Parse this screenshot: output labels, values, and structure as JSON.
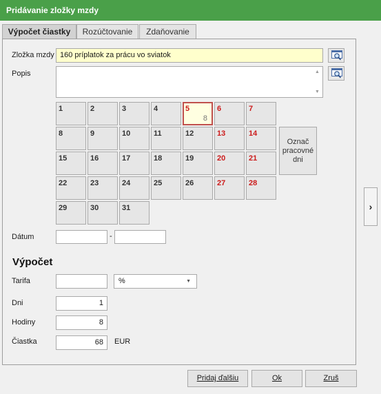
{
  "window": {
    "title": "Pridávanie zložky mzdy"
  },
  "tabs": [
    {
      "label": "Výpočet čiastky",
      "active": true
    },
    {
      "label": "Rozúčtovanie",
      "active": false
    },
    {
      "label": "Zdaňovanie",
      "active": false
    }
  ],
  "form": {
    "component_label": "Zložka mzdy",
    "component_value": "160  príplatok za prácu vo sviatok",
    "description_label": "Popis",
    "description_value": "",
    "date_label": "Dátum",
    "date_from": "",
    "date_separator": "-",
    "date_to": ""
  },
  "calendar": {
    "days": [
      {
        "n": "1",
        "red": false
      },
      {
        "n": "2",
        "red": false
      },
      {
        "n": "3",
        "red": false
      },
      {
        "n": "4",
        "red": false
      },
      {
        "n": "5",
        "red": true,
        "selected": true,
        "hours": "8"
      },
      {
        "n": "6",
        "red": true
      },
      {
        "n": "7",
        "red": true
      },
      {
        "n": "8",
        "red": false
      },
      {
        "n": "9",
        "red": false
      },
      {
        "n": "10",
        "red": false
      },
      {
        "n": "11",
        "red": false
      },
      {
        "n": "12",
        "red": false
      },
      {
        "n": "13",
        "red": true
      },
      {
        "n": "14",
        "red": true
      },
      {
        "n": "15",
        "red": false
      },
      {
        "n": "16",
        "red": false
      },
      {
        "n": "17",
        "red": false
      },
      {
        "n": "18",
        "red": false
      },
      {
        "n": "19",
        "red": false
      },
      {
        "n": "20",
        "red": true
      },
      {
        "n": "21",
        "red": true
      },
      {
        "n": "22",
        "red": false
      },
      {
        "n": "23",
        "red": false
      },
      {
        "n": "24",
        "red": false
      },
      {
        "n": "25",
        "red": false
      },
      {
        "n": "26",
        "red": false
      },
      {
        "n": "27",
        "red": true
      },
      {
        "n": "28",
        "red": true
      },
      {
        "n": "29",
        "red": false
      },
      {
        "n": "30",
        "red": false
      },
      {
        "n": "31",
        "red": false
      }
    ],
    "mark_button_label": "Označ\npracovné\ndni"
  },
  "calculation": {
    "title": "Výpočet",
    "tariff_label": "Tarifa",
    "tariff_value": "",
    "unit_select_value": "%",
    "days_label": "Dni",
    "days_value": "1",
    "hours_label": "Hodiny",
    "hours_value": "8",
    "amount_label": "Čiastka",
    "amount_value": "68",
    "currency": "EUR"
  },
  "buttons": {
    "add_next": "Pridaj ďalšiu",
    "ok": "Ok",
    "cancel": "Zruš"
  },
  "icons": {
    "lookup_component": "magnifier-window-icon",
    "lookup_description": "magnifier-window-icon",
    "expand": "chevron-right-icon",
    "dropdown": "caret-down-icon"
  },
  "colors": {
    "title_bar": "#4aa049",
    "highlight_field": "#ffffcc",
    "weekend_text": "#cc1b1b",
    "selected_day_border": "#c0504d"
  }
}
